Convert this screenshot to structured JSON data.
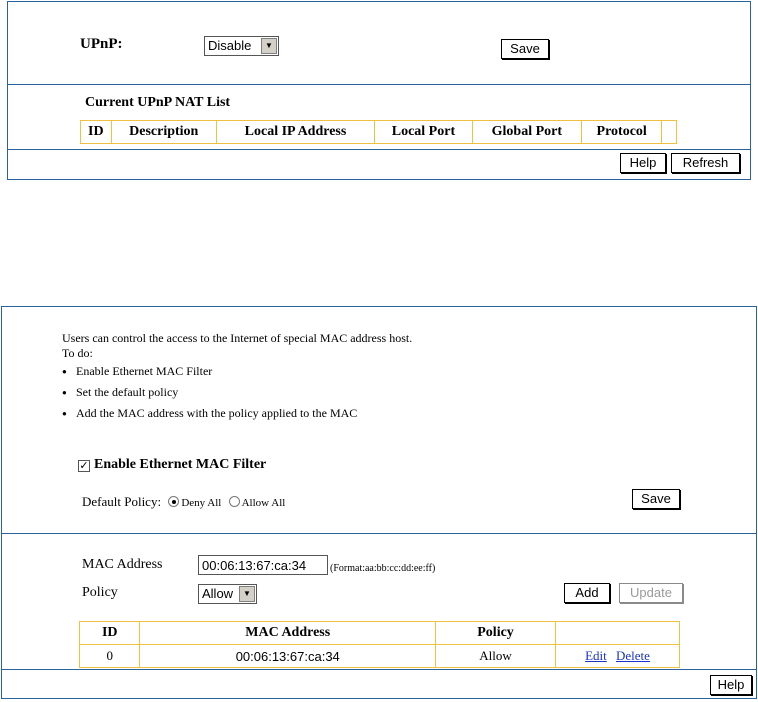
{
  "upnp": {
    "label": "UPnP:",
    "select_value": "Disable",
    "save_label": "Save",
    "list_title": "Current UPnP NAT List",
    "columns": [
      "ID",
      "Description",
      "Local IP Address",
      "Local Port",
      "Global Port",
      "Protocol"
    ],
    "help_label": "Help",
    "refresh_label": "Refresh"
  },
  "macfilter": {
    "intro": "Users can control the access to the Internet of special MAC address host.",
    "todo": "To do:",
    "steps": [
      "Enable Ethernet MAC Filter",
      "Set the default policy",
      "Add the MAC address with the policy applied to the MAC"
    ],
    "check_mark": "✓",
    "enable_label": "Enable Ethernet MAC Filter",
    "default_policy_label": "Default Policy:",
    "deny_all": "Deny All",
    "allow_all": "Allow All",
    "save_label": "Save",
    "mac_label": "MAC Address",
    "mac_value": "00:06:13:67:ca:34",
    "mac_format": "(Format:aa:bb:cc:dd:ee:ff)",
    "policy_label": "Policy",
    "policy_value": "Allow",
    "add_label": "Add",
    "update_label": "Update",
    "columns": [
      "ID",
      "MAC Address",
      "Policy",
      ""
    ],
    "rows": [
      {
        "id": "0",
        "mac": "00:06:13:67:ca:34",
        "policy": "Allow",
        "edit": "Edit",
        "delete": "Delete"
      }
    ],
    "help_label": "Help"
  }
}
